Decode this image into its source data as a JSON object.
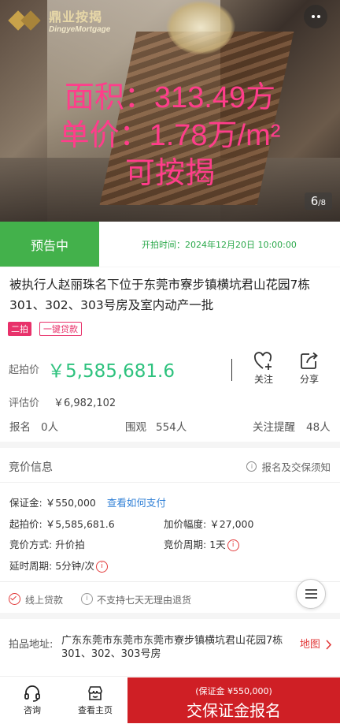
{
  "hero": {
    "logo_cn": "鼎业按揭",
    "logo_en": "DingyeMortgage",
    "overlay_line1": "面积：313.49方",
    "overlay_line2": "单价：1.78万/m²",
    "overlay_line3": "可按揭",
    "image_index": "6",
    "image_total": "/8"
  },
  "status": {
    "badge": "预告中",
    "start_time": "开拍时间：2024年12月20日 10:00:00"
  },
  "listing": {
    "title": "被执行人赵丽珠名下位于东莞市寮步镇横坑君山花园7栋301、302、303号房及室内动产一批",
    "tag_round": "二拍",
    "tag_loan": "一键贷款"
  },
  "price": {
    "start_label": "起拍价",
    "start_value": "￥5,585,681.6",
    "est_label": "评估价",
    "est_value": "￥6,982,102",
    "follow_label": "关注",
    "share_label": "分享"
  },
  "stats": {
    "signup_label": "报名",
    "signup_value": "0人",
    "views_label": "围观",
    "views_value": "554人",
    "reminder_label": "关注提醒",
    "reminder_value": "48人"
  },
  "bid_info": {
    "title": "竞价信息",
    "notice": "报名及交保须知",
    "deposit_label": "保证金: ",
    "deposit_value": "￥550,000",
    "how_to_pay": "查看如何支付",
    "start_label": "起拍价: ",
    "start_value": "￥5,585,681.6",
    "increment_label": "加价幅度: ",
    "increment_value": "￥27,000",
    "method_label": "竞价方式: ",
    "method_value": "升价拍",
    "period_label": "竞价周期: ",
    "period_value": "1天",
    "delay_label": "延时周期: ",
    "delay_value": "5分钟/次"
  },
  "services": {
    "online_loan": "线上贷款",
    "no_return": "不支持七天无理由退货"
  },
  "address": {
    "label": "拍品地址: ",
    "value": "广东东莞市东莞市东莞市寮步镇横坑君山花园7栋301、302、303号房",
    "map": "地图"
  },
  "bottom_bar": {
    "consult": "咨询",
    "home": "查看主页",
    "cta_sub": "(保证金 ¥550,000)",
    "cta_main": "交保证金报名"
  },
  "colors": {
    "status_green": "#43b14b",
    "price_green": "#2ec27e",
    "accent_red": "#cf1f25",
    "overlay_pink": "#ff3d8b",
    "link_blue": "#2f7fd6"
  }
}
